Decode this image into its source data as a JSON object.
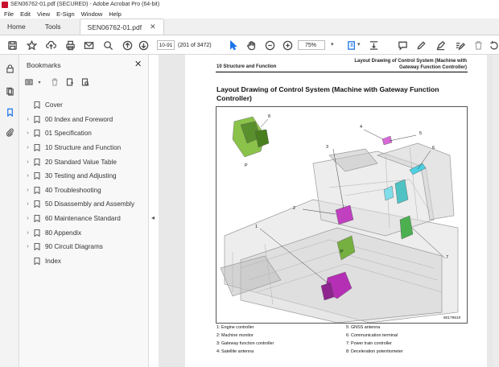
{
  "window": {
    "title": "SEN06762-01.pdf (SECURED) - Adobe Acrobat Pro (64-bit)"
  },
  "menu": [
    "File",
    "Edit",
    "View",
    "E-Sign",
    "Window",
    "Help"
  ],
  "tabs": {
    "home": "Home",
    "tools": "Tools",
    "document": "SEN06762-01.pdf"
  },
  "toolbar": {
    "page_label": "10-91",
    "page_count": "(201 of 3472)",
    "zoom": "75%"
  },
  "panel": {
    "title": "Bookmarks",
    "bookmarks": [
      {
        "label": "Cover",
        "expandable": false
      },
      {
        "label": "00 Index and Foreword",
        "expandable": true
      },
      {
        "label": "01 Specification",
        "expandable": true
      },
      {
        "label": "10 Structure and Function",
        "expandable": true
      },
      {
        "label": "20 Standard Value Table",
        "expandable": true
      },
      {
        "label": "30 Testing and Adjusting",
        "expandable": true
      },
      {
        "label": "40 Troubleshooting",
        "expandable": true
      },
      {
        "label": "50 Disassembly and Assembly",
        "expandable": true
      },
      {
        "label": "60 Maintenance Standard",
        "expandable": true
      },
      {
        "label": "80 Appendix",
        "expandable": true
      },
      {
        "label": "90 Circuit Diagrams",
        "expandable": true
      },
      {
        "label": "Index",
        "expandable": false
      }
    ]
  },
  "document": {
    "header_left": "10 Structure and Function",
    "header_right": "Layout Drawing of Control System (Machine with Gateway Function Controller)",
    "title": "Layout Drawing of Control System (Machine with Gateway Function Controller)",
    "figure_code": "60179510",
    "callouts": {
      "n1": "1",
      "n2": "2",
      "n3": "3",
      "n4": "4",
      "n5": "5",
      "n6": "6",
      "n7": "7",
      "n8": "8",
      "p1": "P",
      "p2": "P"
    },
    "legend": [
      "1: Engine controller",
      "2: Machine monitor",
      "3: Gateway function controller",
      "4: Satellite antenna",
      "5: GNSS antenna",
      "6: Communication terminal",
      "7: Power train controller",
      "8: Deceleration potentiometer"
    ]
  }
}
